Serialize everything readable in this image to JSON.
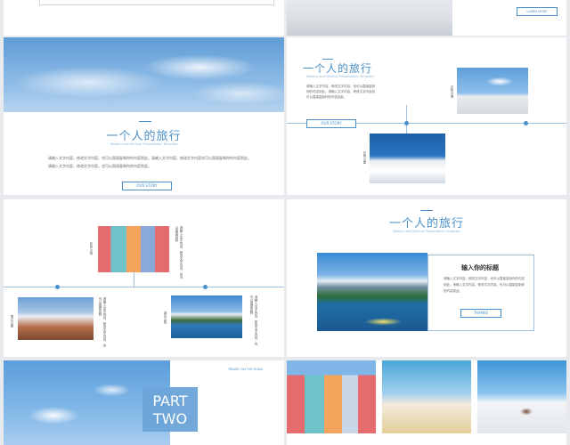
{
  "slides": {
    "s2": {
      "button": "LEARN MORE"
    },
    "s3": {
      "title": "一个人的旅行",
      "subtitle": "Modern and Minimal Presentation Template",
      "para1": "请输入文字内容，修改文字内容，也可以直接复制你的内容到此。请输入文字内容，修改文字内容也可以直接复制你的内容到此。",
      "para2": "请输入文字内容，修改文字内容，也可以直接复制你的内容到此。",
      "button": "OUR STORY"
    },
    "s4": {
      "title": "一个人的旅行",
      "subtitle": "Modern and Minimal Presentation Template",
      "para": "请输入文字内容，修改文字内容，也可以直接复制你的内容到此。请输入文字内容，修改文字内容也可以直接复制你的内容到此。",
      "button": "OUR STORY",
      "label_a": "白色沙滩",
      "label_b": "白色小屋"
    },
    "s5": {
      "label_a": "彩色小镇",
      "label_b": "雪山公路",
      "label_c": "湖光山色",
      "vtext_a": "请输入文字内容，修改文字内容，也可以直接复制",
      "vtext_b": "请输入文字内容，修改文字内容，也可以直接复制",
      "vtext_c": "请输入文字内容，修改文字内容，也可以直接复制"
    },
    "s6": {
      "title": "一个人的旅行",
      "subtitle": "Modern and Minimal Presentation Template",
      "card_title": "输入你的标题",
      "card_para": "请输入文字内容，修改文字内容，也可以直接复制你的内容到此。请输入文字内容，修改文字内容，也可以直接复制你的内容到此。",
      "button": "THANKS"
    },
    "s7": {
      "part": "PART",
      "two": "TWO",
      "tag": "TRAVEL ON THE ROAD"
    }
  },
  "colors": {
    "accent": "#4a8fc9",
    "sky": "#6aa4d8"
  }
}
